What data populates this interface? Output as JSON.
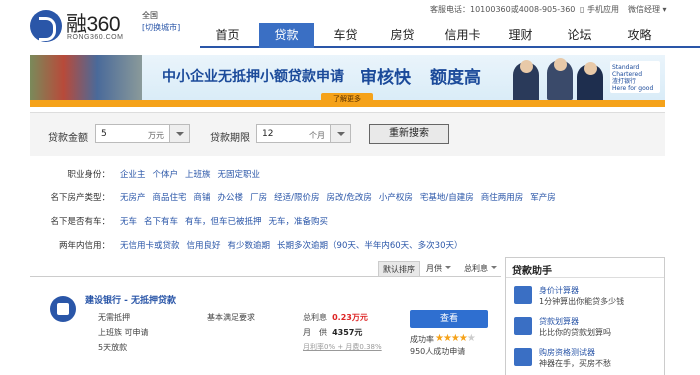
{
  "header": {
    "logo_name": "融360",
    "logo_domain": "RONG360.COM",
    "city": "全国",
    "city_switch": "[切换城市]",
    "hotline": "客服电话：10100360或4008-905-360",
    "mobile": "手机应用",
    "wechat": "微信经理"
  },
  "nav": {
    "items": [
      "首页",
      "贷款",
      "车贷",
      "房贷",
      "信用卡",
      "理财",
      "论坛",
      "攻略"
    ],
    "active": "贷款"
  },
  "banner": {
    "text": "中小企业无抵押小额贷款申请",
    "highlight1": "审核快",
    "highlight2": "额度高",
    "button": "了解更多",
    "sponsor_line1": "Standard",
    "sponsor_line2": "Chartered",
    "sponsor_line3": "渣打银行",
    "sponsor_line4": "Here for good"
  },
  "search": {
    "amount_label": "贷款金额",
    "amount_value": "5",
    "amount_unit": "万元",
    "term_label": "贷款期限",
    "term_value": "12",
    "term_unit": "个月",
    "button": "重新搜索"
  },
  "filters": [
    {
      "label": "职业身份：",
      "options": [
        "企业主",
        "个体户",
        "上班族",
        "无固定职业"
      ]
    },
    {
      "label": "名下房产类型：",
      "options": [
        "无房产",
        "商品住宅",
        "商铺",
        "办公楼",
        "厂房",
        "经适/限价房",
        "房改/危改房",
        "小产权房",
        "宅基地/自建房",
        "商住两用房",
        "军产房"
      ]
    },
    {
      "label": "名下是否有车：",
      "options": [
        "无车",
        "名下有车",
        "有车，但车已被抵押",
        "无车，准备购买"
      ]
    },
    {
      "label": "两年内信用：",
      "options": [
        "无信用卡或贷款",
        "信用良好",
        "有少数逾期",
        "长期多次逾期（90天、半年内60天、多次30天）"
      ]
    }
  ],
  "list": {
    "sort_default": "默认排序",
    "sort_monthly": "月供",
    "sort_interest": "总利息"
  },
  "product": {
    "name": "建设银行 - 无抵押贷款",
    "tag1": "无需抵押",
    "tag2": "上班族 可申请",
    "tag3": "5天放款",
    "requirement": "基本满足要求",
    "interest_label": "总利息",
    "interest_value": "0.23万元",
    "monthly_label": "月　供",
    "monthly_value": "4357元",
    "fee_note": "月利率0% + 月费0.38%",
    "apply": "查看",
    "success_label": "成功率",
    "stars": "★★★★",
    "star_empty": "★",
    "success_count": "950人成功申请"
  },
  "assistant": {
    "title": "贷款助手",
    "tools": [
      {
        "title": "身价计算器",
        "desc": "1分钟算出你能贷多少钱",
        "icon": "calculator-icon"
      },
      {
        "title": "贷款划算器",
        "desc": "比比你的贷款划算吗",
        "icon": "scale-icon"
      },
      {
        "title": "购房资格测试器",
        "desc": "神器在手，买房不愁",
        "icon": "house-icon"
      }
    ]
  },
  "colors": {
    "brand_blue": "#2a56a8",
    "nav_active": "#3a6fc4",
    "accent_orange": "#f5a21a",
    "rate_red": "#d22"
  }
}
